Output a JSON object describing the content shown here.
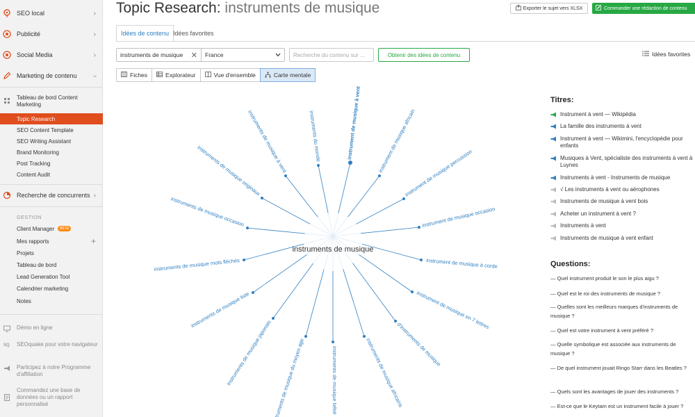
{
  "header": {
    "title_prefix": "Topic Research:",
    "title_keyword": "instruments de musique",
    "export_label": "Exporter le sujet vers XLSX",
    "order_label": "Commander une rédaction de contenu"
  },
  "tabs": [
    {
      "label": "Idées de contenu"
    },
    {
      "label": "Idées favorites"
    }
  ],
  "filters": {
    "keyword_value": "instruments de musique",
    "country_value": "France",
    "search_placeholder": "Recherche du contenu sur ...",
    "get_ideas_label": "Obtenir des idées de contenu",
    "favorites_label": "Idées favorites"
  },
  "views": [
    {
      "label": "Fiches"
    },
    {
      "label": "Explorateur"
    },
    {
      "label": "Vue d'ensemble"
    },
    {
      "label": "Carte mentale"
    }
  ],
  "sidebar": {
    "items": [
      {
        "label": "SEO local",
        "icon": "pin-icon"
      },
      {
        "label": "Publicité",
        "icon": "target-icon"
      },
      {
        "label": "Social Media",
        "icon": "target-icon"
      },
      {
        "label": "Marketing de contenu",
        "icon": "pencil-icon"
      }
    ],
    "content_marketing": [
      "Tableau de bord Content Marketing",
      "Topic Research",
      "SEO Content Template",
      "SEO Writing Assistant",
      "Brand Monitoring",
      "Post Tracking",
      "Content Audit"
    ],
    "competitors_label": "Recherche de concurrents",
    "gestion_label": "GESTION",
    "gestion_items": [
      "Client Manager",
      "Mes rapports",
      "Projets",
      "Tableau de bord",
      "Lead Generation Tool",
      "Calendrier marketing",
      "Notes"
    ],
    "beta_badge": "BETA",
    "footer": [
      "Démo en ligne",
      "SEOquake pour votre navigateur",
      "Participez à notre Programme d'affiliation",
      "Commandez une base de données ou un rapport personnalisé"
    ]
  },
  "mindmap": {
    "center": "instruments de musique",
    "accent_color": "#2f7fc1",
    "highlighted": "instrument de musique à vent",
    "branches": [
      "instrument de musique à vent",
      "instrument de musique africain",
      "instrument de musique percussion",
      "instrument de musique occasion",
      "instrument de musique à corde",
      "instrument de musique en 7 lettres",
      "d'instruments de musique",
      "instruments de musique africains",
      "instruments de musique bébé",
      "truments de musique du moyen age",
      "instruments de musique japonais",
      "instruments de musique liste",
      "instruments de musique mots fléchés",
      "instruments de musique occasion",
      "instruments de musique originaux",
      "instruments de musique à vent",
      "instruments du monde"
    ]
  },
  "right_panel": {
    "titles_heading": "Titres:",
    "titles": [
      "Instrument à vent — Wikipédia",
      "La famille des instruments à vent",
      "Instrument à vent — Wikimini, l'encyclopédie pour enfants",
      "Musiques à Vent, spécialiste des instruments à vent à Luynes",
      "Instruments à vent - Instruments de musique",
      "√ Les instruments à vent ou aérophones",
      "Instruments de musique à vent bois",
      "Acheter un instrument à vent ?",
      "Instruments à vent",
      "Instruments de musique à vent enfant"
    ],
    "questions_heading": "Questions:",
    "questions": [
      "— Quel instrument produit le son le plus aigu ?",
      "— Quel est le roi des instruments de musique ?",
      "— Quelles sont les meilleurs marques d'instruments de musique ?",
      "— Quel est votre instrument à vent préféré ?",
      "— Quelle symbolique est associée aux instruments de musique ?",
      "— De quel instrument jouait Ringo Starr dans les Beatles ?",
      "— Quels sont les avantages de jouer des instruments ?",
      "— Est-ce que le Keytam est un instrument facile à jouer ?"
    ]
  }
}
